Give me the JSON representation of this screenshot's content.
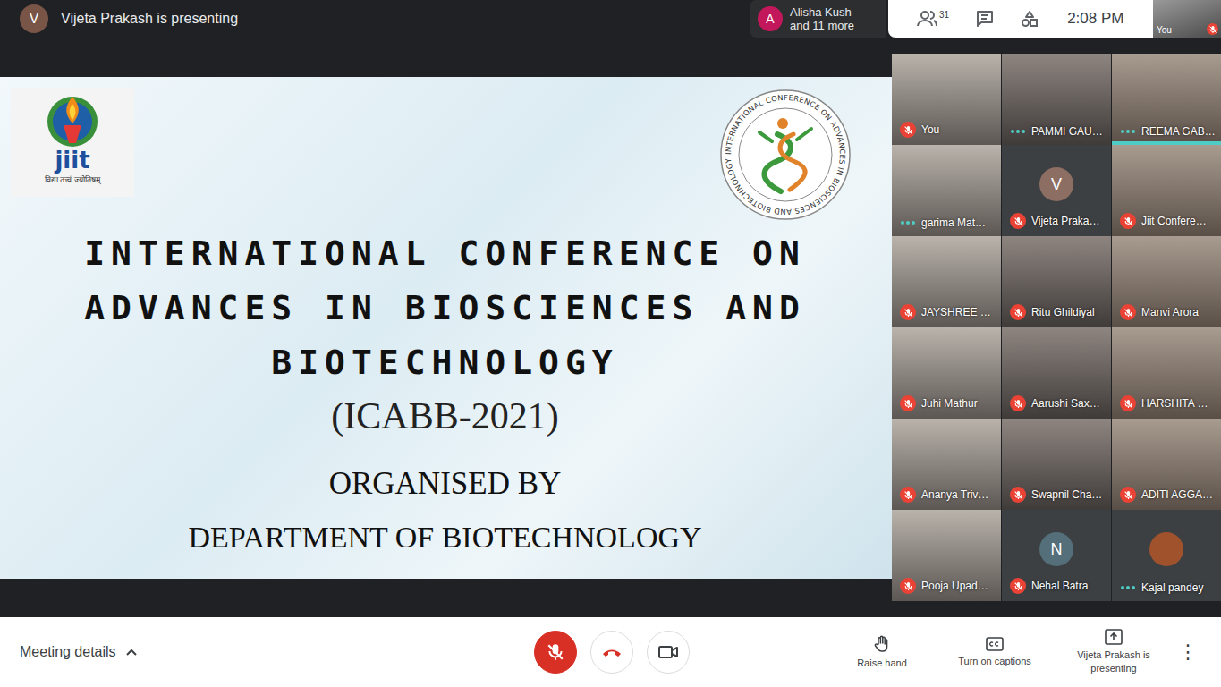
{
  "presenter_banner": {
    "initial": "V",
    "color": "#795548",
    "text": "Vijeta Prakash is presenting"
  },
  "participants_pill": {
    "initial": "A",
    "color": "#c2185b",
    "line1": "Alisha Kush",
    "line2": "and 11 more"
  },
  "toolbar": {
    "participant_count": "31",
    "time": "2:08 PM"
  },
  "self_view": {
    "label": "You",
    "muted": true
  },
  "slide": {
    "jiit_logo": {
      "name": "jiit",
      "motto": "विद्या तत्त्वं ज्योतिषम्"
    },
    "ring_logo_text": "INTERNATIONAL CONFERENCE ON ADVANCES IN BIOSCIENCES AND BIOTECHNOLOGY",
    "title_lines": [
      "INTERNATIONAL CONFERENCE ON",
      "ADVANCES IN BIOSCIENCES AND",
      "BIOTECHNOLOGY"
    ],
    "acronym": "(ICABB-2021)",
    "organised_by": "ORGANISED BY",
    "department": "DEPARTMENT OF BIOTECHNOLOGY"
  },
  "tiles": [
    {
      "name": "You",
      "kind": "video",
      "muted": true,
      "speaking": false
    },
    {
      "name": "PAMMI GAU…",
      "kind": "video",
      "muted": false,
      "speaking": false
    },
    {
      "name": "REEMA GAB…",
      "kind": "video",
      "muted": false,
      "speaking": true
    },
    {
      "name": "garima Mat…",
      "kind": "video",
      "muted": false,
      "speaking": false
    },
    {
      "name": "Vijeta Praka…",
      "kind": "letter",
      "initial": "V",
      "color": "#8d6e63",
      "muted": true,
      "speaking": false
    },
    {
      "name": "Jiit Confere…",
      "kind": "video",
      "muted": true,
      "speaking": false
    },
    {
      "name": "JAYSHREE …",
      "kind": "video",
      "muted": true,
      "speaking": false
    },
    {
      "name": "Ritu Ghildiyal",
      "kind": "video",
      "muted": true,
      "speaking": false
    },
    {
      "name": "Manvi Arora",
      "kind": "video",
      "muted": true,
      "speaking": false
    },
    {
      "name": "Juhi Mathur",
      "kind": "video",
      "muted": true,
      "speaking": false
    },
    {
      "name": "Aarushi Sax…",
      "kind": "video",
      "muted": true,
      "speaking": false
    },
    {
      "name": "HARSHITA …",
      "kind": "video",
      "muted": true,
      "speaking": false
    },
    {
      "name": "Ananya Triv…",
      "kind": "video",
      "muted": true,
      "speaking": false
    },
    {
      "name": "Swapnil Cha…",
      "kind": "video",
      "muted": true,
      "speaking": false
    },
    {
      "name": "ADITI AGGA…",
      "kind": "video",
      "muted": true,
      "speaking": false
    },
    {
      "name": "Pooja Upad…",
      "kind": "video",
      "muted": true,
      "speaking": false
    },
    {
      "name": "Nehal Batra",
      "kind": "letter",
      "initial": "N",
      "color": "#546e7a",
      "muted": true,
      "speaking": false
    },
    {
      "name": "Kajal pandey",
      "kind": "photo",
      "color": "#a0522d",
      "muted": false,
      "speaking": false
    }
  ],
  "bottom_bar": {
    "meeting_details": "Meeting details",
    "mic_muted": true,
    "camera_on": true,
    "actions": [
      "Raise hand",
      "Turn on captions",
      "Vijeta Prakash is presenting"
    ],
    "more": "⋮"
  }
}
